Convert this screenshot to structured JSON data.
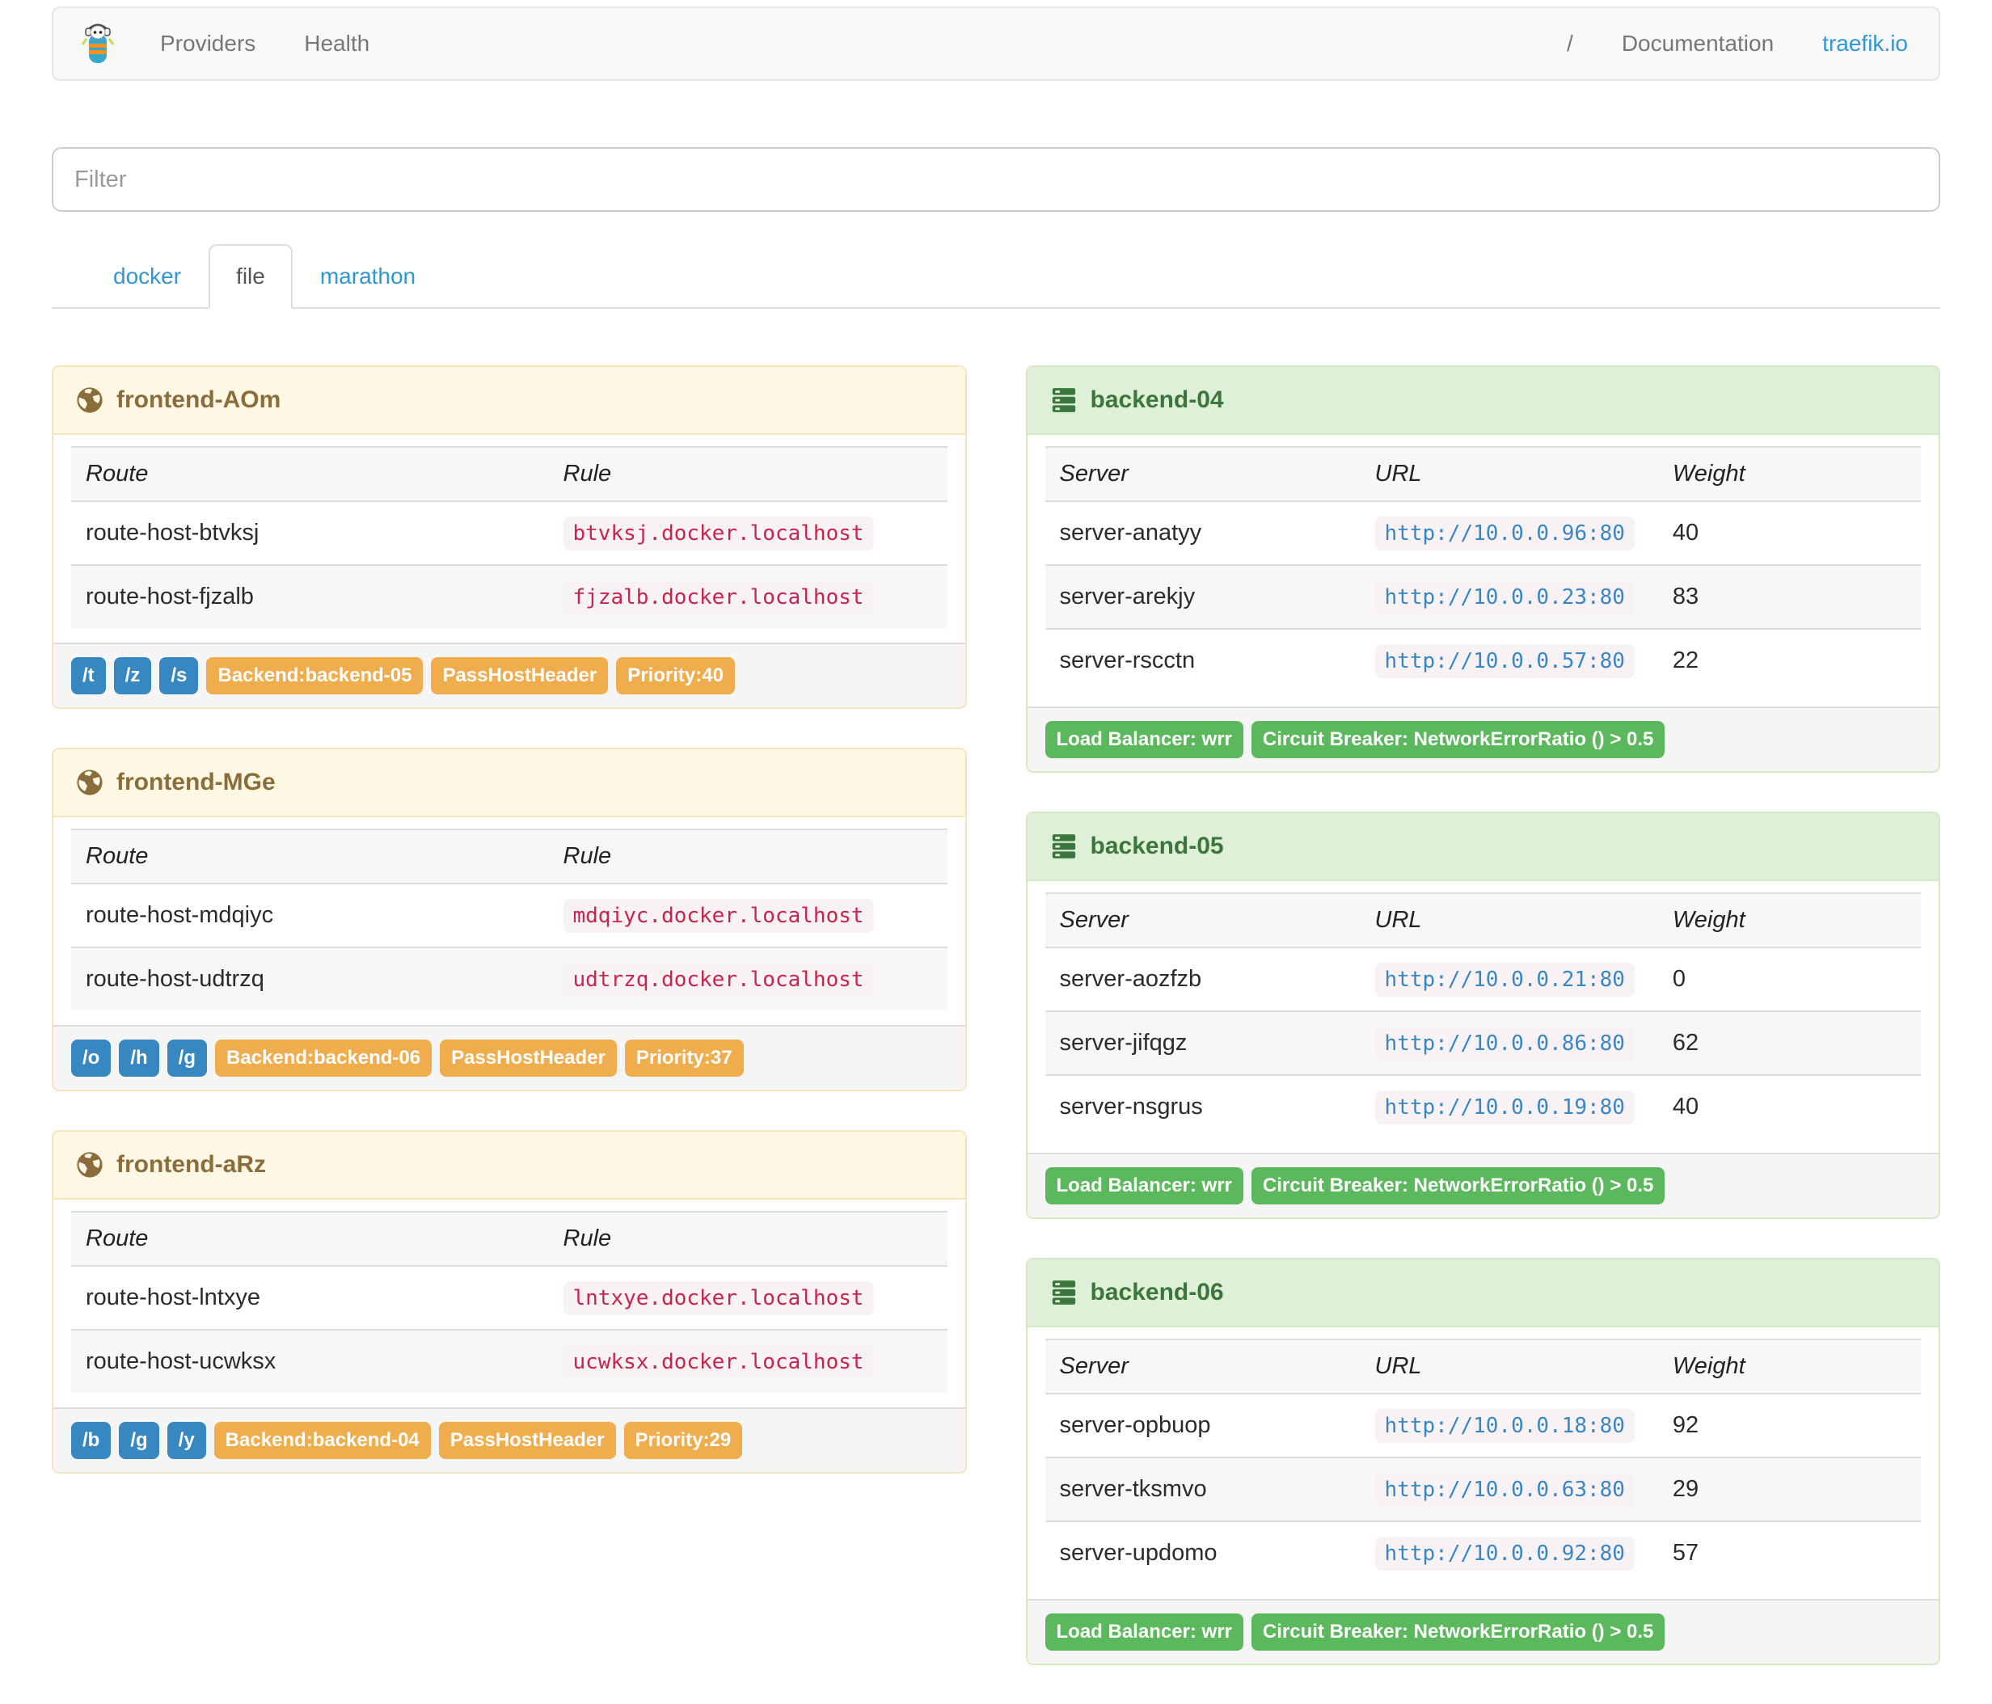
{
  "navbar": {
    "brand": "traefik",
    "links": [
      "Providers",
      "Health"
    ],
    "right_links": [
      "/",
      "Documentation",
      "traefik.io"
    ]
  },
  "filter": {
    "placeholder": "Filter"
  },
  "tabs": [
    {
      "label": "docker",
      "active": false
    },
    {
      "label": "file",
      "active": true
    },
    {
      "label": "marathon",
      "active": false
    }
  ],
  "frontend_columns": [
    "Route",
    "Rule"
  ],
  "backend_columns": [
    "Server",
    "URL",
    "Weight"
  ],
  "frontends": [
    {
      "title": "frontend-AOm",
      "routes": [
        {
          "route": "route-host-btvksj",
          "rule": "btvksj.docker.localhost"
        },
        {
          "route": "route-host-fjzalb",
          "rule": "fjzalb.docker.localhost"
        }
      ],
      "entries": [
        "/t",
        "/z",
        "/s"
      ],
      "tags": [
        "Backend:backend-05",
        "PassHostHeader",
        "Priority:40"
      ]
    },
    {
      "title": "frontend-MGe",
      "routes": [
        {
          "route": "route-host-mdqiyc",
          "rule": "mdqiyc.docker.localhost"
        },
        {
          "route": "route-host-udtrzq",
          "rule": "udtrzq.docker.localhost"
        }
      ],
      "entries": [
        "/o",
        "/h",
        "/g"
      ],
      "tags": [
        "Backend:backend-06",
        "PassHostHeader",
        "Priority:37"
      ]
    },
    {
      "title": "frontend-aRz",
      "routes": [
        {
          "route": "route-host-lntxye",
          "rule": "lntxye.docker.localhost"
        },
        {
          "route": "route-host-ucwksx",
          "rule": "ucwksx.docker.localhost"
        }
      ],
      "entries": [
        "/b",
        "/g",
        "/y"
      ],
      "tags": [
        "Backend:backend-04",
        "PassHostHeader",
        "Priority:29"
      ]
    }
  ],
  "backends": [
    {
      "title": "backend-04",
      "servers": [
        {
          "server": "server-anatyy",
          "url": "http://10.0.0.96:80",
          "weight": "40"
        },
        {
          "server": "server-arekjy",
          "url": "http://10.0.0.23:80",
          "weight": "83"
        },
        {
          "server": "server-rscctn",
          "url": "http://10.0.0.57:80",
          "weight": "22"
        }
      ],
      "tags": [
        "Load Balancer: wrr",
        "Circuit Breaker: NetworkErrorRatio () > 0.5"
      ]
    },
    {
      "title": "backend-05",
      "servers": [
        {
          "server": "server-aozfzb",
          "url": "http://10.0.0.21:80",
          "weight": "0"
        },
        {
          "server": "server-jifqgz",
          "url": "http://10.0.0.86:80",
          "weight": "62"
        },
        {
          "server": "server-nsgrus",
          "url": "http://10.0.0.19:80",
          "weight": "40"
        }
      ],
      "tags": [
        "Load Balancer: wrr",
        "Circuit Breaker: NetworkErrorRatio () > 0.5"
      ]
    },
    {
      "title": "backend-06",
      "servers": [
        {
          "server": "server-opbuop",
          "url": "http://10.0.0.18:80",
          "weight": "92"
        },
        {
          "server": "server-tksmvo",
          "url": "http://10.0.0.63:80",
          "weight": "29"
        },
        {
          "server": "server-updomo",
          "url": "http://10.0.0.92:80",
          "weight": "57"
        }
      ],
      "tags": [
        "Load Balancer: wrr",
        "Circuit Breaker: NetworkErrorRatio () > 0.5"
      ]
    }
  ],
  "colors": {
    "link-blue": "#3097d1",
    "warn-bg": "#fcf8e3",
    "warn-border": "#f5e4bc",
    "warn-text": "#8a6d3b",
    "success-bg": "#dff0d8",
    "success-border": "#d6e9c6",
    "success-text": "#3c763d",
    "label-blue": "#3787c0",
    "label-orange": "#f0ad4e",
    "label-green": "#5cb85c",
    "code-red": "#c7254e",
    "code-blue": "#3787c7",
    "code-bg": "#f9f2f4"
  }
}
